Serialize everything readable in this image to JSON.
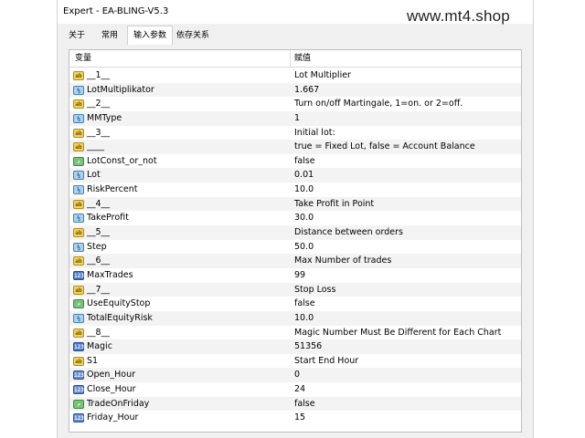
{
  "window": {
    "title": "Expert - EA-BLING-V5.3"
  },
  "watermark": "www.mt4.shop",
  "tabs": [
    {
      "label": "关于"
    },
    {
      "label": "常用"
    },
    {
      "label": "输入参数",
      "active": true
    },
    {
      "label": "依存关系"
    }
  ],
  "table": {
    "headers": {
      "variable": "变量",
      "value": "赋值"
    },
    "rows": [
      {
        "icon": "ab",
        "name": "__1__",
        "value": "Lot Multiplier"
      },
      {
        "icon": "v12",
        "name": "LotMultiplikator",
        "value": "1.667"
      },
      {
        "icon": "ab",
        "name": "__2__",
        "value": " Turn on/off Martingale,  1=on. or 2=off."
      },
      {
        "icon": "v12",
        "name": "MMType",
        "value": "1"
      },
      {
        "icon": "ab",
        "name": "__3__",
        "value": "Initial lot:"
      },
      {
        "icon": "ab",
        "name": "____",
        "value": "true = Fixed Lot, false = Account Balance"
      },
      {
        "icon": "bool",
        "name": "LotConst_or_not",
        "value": "false"
      },
      {
        "icon": "v12",
        "name": "Lot",
        "value": "0.01"
      },
      {
        "icon": "v12",
        "name": "RiskPercent",
        "value": "10.0"
      },
      {
        "icon": "ab",
        "name": "__4__",
        "value": "Take Profit in Point"
      },
      {
        "icon": "v12",
        "name": "TakeProfit",
        "value": "30.0"
      },
      {
        "icon": "ab",
        "name": "__5__",
        "value": "Distance between orders"
      },
      {
        "icon": "v12",
        "name": "Step",
        "value": "50.0"
      },
      {
        "icon": "ab",
        "name": "__6__",
        "value": "Max Number of trades"
      },
      {
        "icon": "num",
        "name": "MaxTrades",
        "value": "99"
      },
      {
        "icon": "ab",
        "name": "__7__",
        "value": "Stop Loss"
      },
      {
        "icon": "bool",
        "name": "UseEquityStop",
        "value": "false"
      },
      {
        "icon": "v12",
        "name": "TotalEquityRisk",
        "value": "10.0"
      },
      {
        "icon": "ab",
        "name": "__8__",
        "value": "Magic Number Must Be Different for Each Chart"
      },
      {
        "icon": "num",
        "name": "Magic",
        "value": "51356"
      },
      {
        "icon": "ab",
        "name": "S1",
        "value": " Start End Hour"
      },
      {
        "icon": "num2",
        "name": "Open_Hour",
        "value": "0"
      },
      {
        "icon": "num2",
        "name": "Close_Hour",
        "value": "24"
      },
      {
        "icon": "bool",
        "name": "TradeOnFriday",
        "value": "false"
      },
      {
        "icon": "num2",
        "name": "Friday_Hour",
        "value": "15"
      }
    ]
  }
}
